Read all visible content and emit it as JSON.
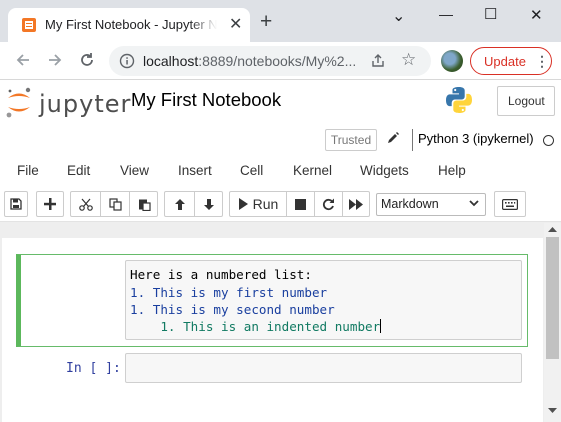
{
  "browser": {
    "tab_title": "My First Notebook - Jupyter Notebook",
    "tab_close": "✕",
    "new_tab": "+",
    "url_host": "localhost",
    "url_rest": ":8889/notebooks/My%2...",
    "update_label": "Update",
    "menu_dots": "⋮",
    "window_controls": [
      "⌄",
      "—",
      "☐",
      "✕"
    ]
  },
  "header": {
    "logo_text": "jupyter",
    "notebook_title": "My First Notebook",
    "logout_label": "Logout"
  },
  "kernel": {
    "trusted_label": "Trusted",
    "kernel_name": "Python 3 (ipykernel)"
  },
  "menu": {
    "items": [
      "File",
      "Edit",
      "View",
      "Insert",
      "Cell",
      "Kernel",
      "Widgets",
      "Help"
    ]
  },
  "toolbar": {
    "run_label": "Run",
    "cell_type": "Markdown"
  },
  "cells": [
    {
      "type": "markdown",
      "lines": [
        "Here is a numbered list:",
        "1. This is my first number",
        "1. This is my second number",
        "    1. This is an indented number"
      ]
    },
    {
      "type": "code",
      "prompt": "In [ ]:",
      "content": ""
    }
  ],
  "icons": [
    "jupyter-favicon-icon",
    "back-arrow-icon",
    "forward-arrow-icon",
    "reload-icon",
    "info-icon",
    "share-icon",
    "star-icon",
    "python-logo-icon",
    "pencil-icon",
    "save-icon",
    "plus-icon",
    "cut-icon",
    "copy-icon",
    "paste-icon",
    "arrow-up-icon",
    "arrow-down-icon",
    "play-icon",
    "stop-icon",
    "restart-icon",
    "fast-forward-icon",
    "keyboard-icon"
  ],
  "colors": {
    "jupyter_orange": "#f37726",
    "selected_cell_border": "#5cb85c",
    "update_red": "#d93025",
    "prompt_blue": "#303f9f"
  }
}
